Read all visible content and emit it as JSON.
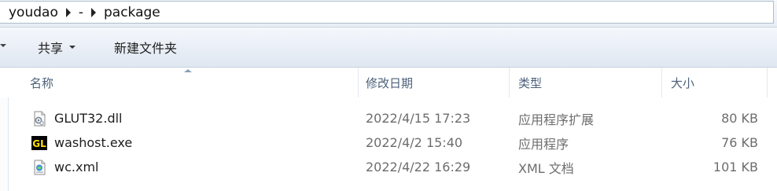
{
  "addressbar": {
    "crumbs": [
      "youdao",
      "-",
      "package"
    ]
  },
  "toolbar": {
    "share_label": "共享",
    "newfolder_label": "新建文件夹"
  },
  "columns": {
    "name": "名称",
    "date": "修改日期",
    "type": "类型",
    "size": "大小"
  },
  "files": [
    {
      "name": "GLUT32.dll",
      "date": "2022/4/15 17:23",
      "type": "应用程序扩展",
      "size": "80 KB",
      "icon": "dll-file-icon"
    },
    {
      "name": "washost.exe",
      "date": "2022/4/2 15:40",
      "type": "应用程序",
      "size": "76 KB",
      "icon": "gl-exe-icon"
    },
    {
      "name": "wc.xml",
      "date": "2022/4/22 16:29",
      "type": "XML 文档",
      "size": "101 KB",
      "icon": "xml-file-icon"
    }
  ],
  "colors": {
    "header_text": "#4c607a",
    "secondary_text": "#6d6d6d"
  }
}
